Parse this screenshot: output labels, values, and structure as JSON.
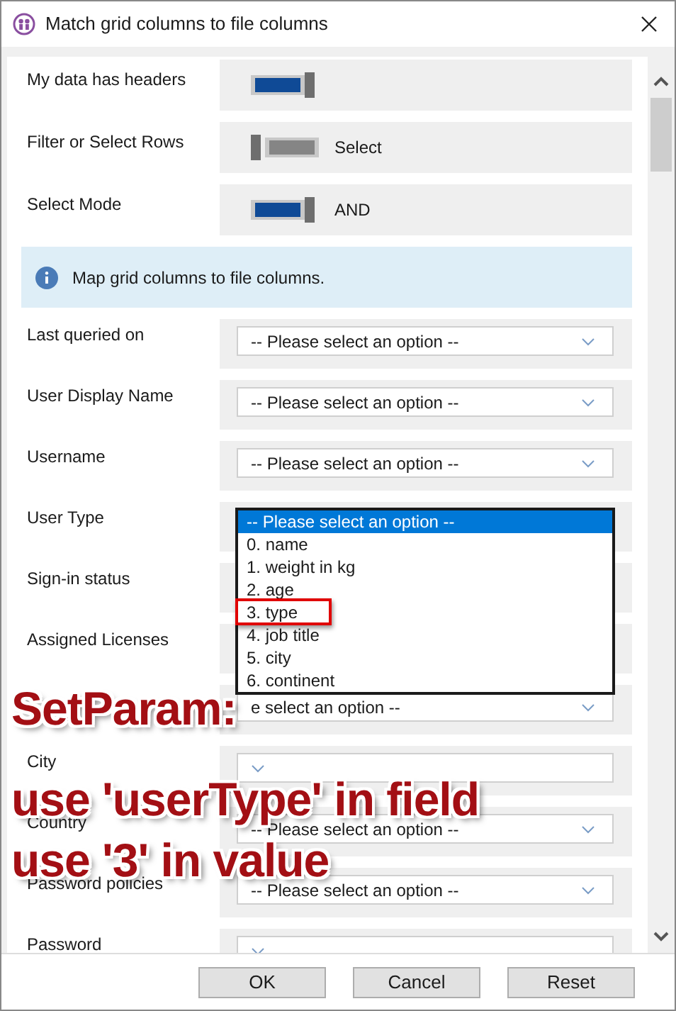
{
  "window": {
    "title": "Match grid columns to file columns"
  },
  "settings": [
    {
      "label": "My data has headers",
      "on": true
    },
    {
      "label": "Filter or Select Rows",
      "on": false,
      "value": "Select"
    },
    {
      "label": "Select Mode",
      "on": true,
      "value": "AND"
    }
  ],
  "info": "Map grid columns to file columns.",
  "mappings": [
    {
      "label": "Last queried on",
      "value": "-- Please select an option --"
    },
    {
      "label": "User Display Name",
      "value": "-- Please select an option --"
    },
    {
      "label": "Username",
      "value": "-- Please select an option --"
    },
    {
      "label": "User Type",
      "expanded": true
    },
    {
      "label": "Sign-in status"
    },
    {
      "label": "Assigned Licenses"
    },
    {
      "value": "e select an option --"
    },
    {
      "label": "City"
    },
    {
      "label": "Country",
      "value": "-- Please select an option --"
    },
    {
      "label": "Password policies",
      "value": "-- Please select an option --"
    },
    {
      "label": "Password"
    }
  ],
  "dropdown": {
    "options": [
      {
        "label": "-- Please select an option --",
        "selected": true,
        "marked": false
      },
      {
        "label": "0. name",
        "selected": false,
        "marked": false
      },
      {
        "label": "1. weight in kg",
        "selected": false,
        "marked": false
      },
      {
        "label": "2. age",
        "selected": false,
        "marked": false
      },
      {
        "label": "3. type",
        "selected": false,
        "marked": true
      },
      {
        "label": "4. job title",
        "selected": false,
        "marked": false
      },
      {
        "label": "5. city",
        "selected": false,
        "marked": false
      },
      {
        "label": "6. continent",
        "selected": false,
        "marked": false
      }
    ]
  },
  "annotation": [
    "SetParam:",
    "use 'userType' in field",
    "use '3' in value"
  ],
  "buttons": [
    "OK",
    "Cancel",
    "Reset"
  ]
}
